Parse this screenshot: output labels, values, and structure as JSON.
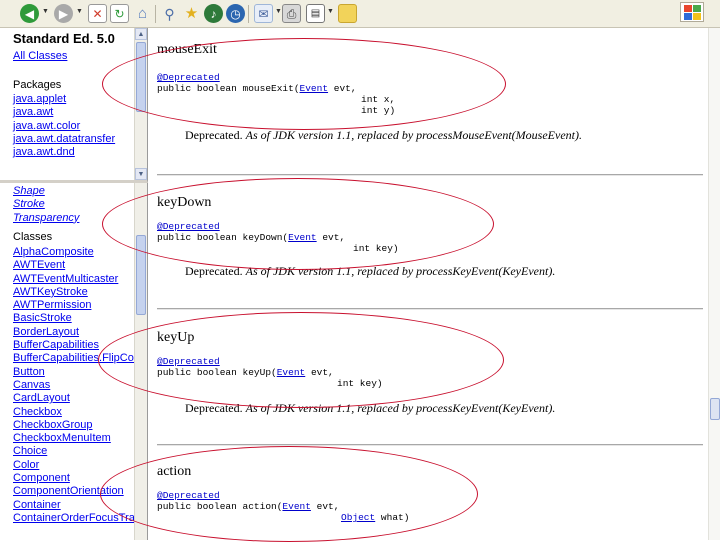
{
  "toolbar": {
    "buttons": [
      {
        "name": "back-button",
        "icon": "back-arrow-icon",
        "color": "#2e9a3a"
      },
      {
        "name": "forward-button",
        "icon": "forward-arrow-icon",
        "color": "#9a9a9a"
      },
      {
        "name": "stop-button",
        "icon": "stop-icon",
        "color": "#d13b2a"
      },
      {
        "name": "refresh-button",
        "icon": "refresh-icon",
        "color": "#2e9a3a"
      },
      {
        "name": "home-button",
        "icon": "home-icon",
        "color": "#5a7fbf"
      },
      {
        "name": "search-button",
        "icon": "search-icon",
        "color": "#6a8fc6"
      },
      {
        "name": "favorites-button",
        "icon": "star-icon",
        "color": "#e3b11f"
      },
      {
        "name": "media-button",
        "icon": "media-icon",
        "color": "#2e7a3a"
      },
      {
        "name": "history-button",
        "icon": "history-icon",
        "color": "#2b66b0"
      },
      {
        "name": "mail-button",
        "icon": "mail-icon",
        "color": "#9fb6d8"
      },
      {
        "name": "print-button",
        "icon": "print-icon",
        "color": "#8a8a8a"
      },
      {
        "name": "edit-button",
        "icon": "edit-icon",
        "color": "#555555"
      },
      {
        "name": "messenger-button",
        "icon": "folder-icon",
        "color": "#f2d35a"
      }
    ]
  },
  "packages_frame": {
    "title": "Standard Ed. 5.0",
    "all_classes": "All Classes",
    "packages_label": "Packages",
    "packages": [
      "java.applet",
      "java.awt",
      "java.awt.color",
      "java.awt.datatransfer",
      "java.awt.dnd"
    ]
  },
  "classes_frame": {
    "interfaces": [
      "Shape",
      "Stroke",
      "Transparency"
    ],
    "classes_label": "Classes",
    "classes": [
      "AlphaComposite",
      "AWTEvent",
      "AWTEventMulticaster",
      "AWTKeyStroke",
      "AWTPermission",
      "BasicStroke",
      "BorderLayout",
      "BufferCapabilities",
      "BufferCapabilities.FlipContents",
      "Button",
      "Canvas",
      "CardLayout",
      "Checkbox",
      "CheckboxGroup",
      "CheckboxMenuItem",
      "Choice",
      "Color",
      "Component",
      "ComponentOrientation",
      "Container",
      "ContainerOrderFocusTraversalPolicy"
    ]
  },
  "methods": [
    {
      "name": "mouseExit",
      "annotation": "@Deprecated",
      "sig_prefix": "public boolean mouseExit(",
      "param1_type": "Event",
      "param1_rest": " evt,",
      "param2": "int x,",
      "param3": "int y)",
      "deprecated_label": "Deprecated.",
      "deprecated_text": "As of JDK version 1.1, replaced by processMouseEvent(MouseEvent)."
    },
    {
      "name": "keyDown",
      "annotation": "@Deprecated",
      "sig_prefix": "public boolean keyDown(",
      "param1_type": "Event",
      "param1_rest": " evt,",
      "param2": "int key)",
      "deprecated_label": "Deprecated.",
      "deprecated_text": "As of JDK version 1.1, replaced by processKeyEvent(KeyEvent)."
    },
    {
      "name": "keyUp",
      "annotation": "@Deprecated",
      "sig_prefix": "public boolean keyUp(",
      "param1_type": "Event",
      "param1_rest": " evt,",
      "param2": "int key)",
      "deprecated_label": "Deprecated.",
      "deprecated_text": "As of JDK version 1.1, replaced by processKeyEvent(KeyEvent)."
    },
    {
      "name": "action",
      "annotation": "@Deprecated",
      "sig_prefix": "public boolean action(",
      "param1_type": "Event",
      "param1_rest": " evt,",
      "param2_type": "Object",
      "param2_rest": " what)"
    }
  ],
  "highlight_color": "#c8102e"
}
